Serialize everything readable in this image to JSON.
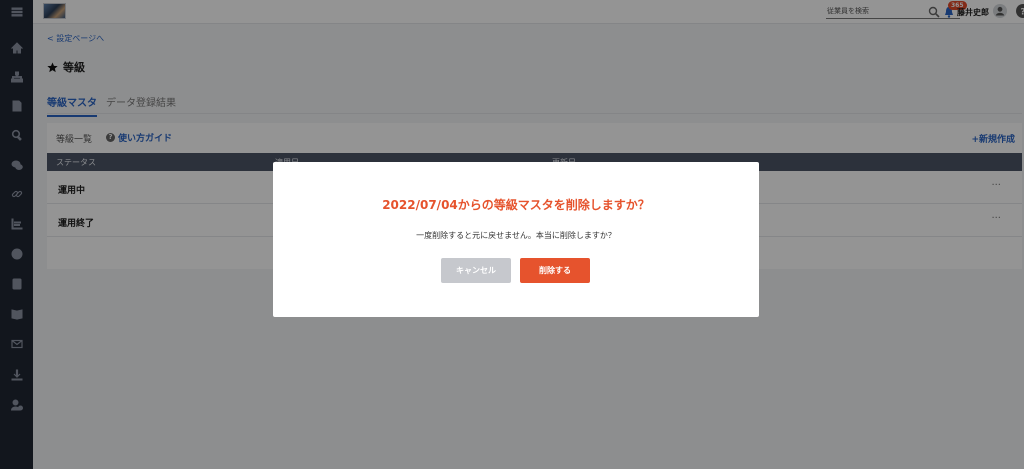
{
  "header": {
    "search_placeholder": "従業員を検索",
    "notification_count": "365",
    "user_name": "藤井史郎"
  },
  "sidebar": {
    "items": [
      {
        "icon": "menu-icon"
      },
      {
        "icon": "home-icon"
      },
      {
        "icon": "org-chart-icon"
      },
      {
        "icon": "document-icon"
      },
      {
        "icon": "search-icon"
      },
      {
        "icon": "chat-icon"
      },
      {
        "icon": "link-icon"
      },
      {
        "icon": "analytics-icon"
      },
      {
        "icon": "info-icon"
      },
      {
        "icon": "contact-card-icon"
      },
      {
        "icon": "book-icon"
      },
      {
        "icon": "mail-icon"
      },
      {
        "icon": "download-icon"
      },
      {
        "icon": "user-settings-icon"
      }
    ]
  },
  "main": {
    "back_link": "< 設定ページへ",
    "page_title": "等級",
    "tabs": [
      {
        "label": "等級マスタ",
        "active": true
      },
      {
        "label": "データ登録結果",
        "active": false
      }
    ],
    "list_title": "等級一覧",
    "guide_label": "使い方ガイド",
    "new_label": "+新規作成",
    "table": {
      "columns": [
        "ステータス",
        "適用日",
        "更新日"
      ],
      "rows": [
        {
          "status": "運用中",
          "menu": "···"
        },
        {
          "status": "運用終了",
          "menu": "···"
        }
      ]
    }
  },
  "dialog": {
    "title": "2022/07/04からの等級マスタを削除しますか？",
    "message": "一度削除すると元に戻せません。本当に削除しますか？",
    "cancel_label": "キャンセル",
    "delete_label": "削除する"
  },
  "colors": {
    "sidebar": "#1f2633",
    "accent": "#2a64c4",
    "danger": "#e6532d",
    "table_header": "#4c5566"
  }
}
